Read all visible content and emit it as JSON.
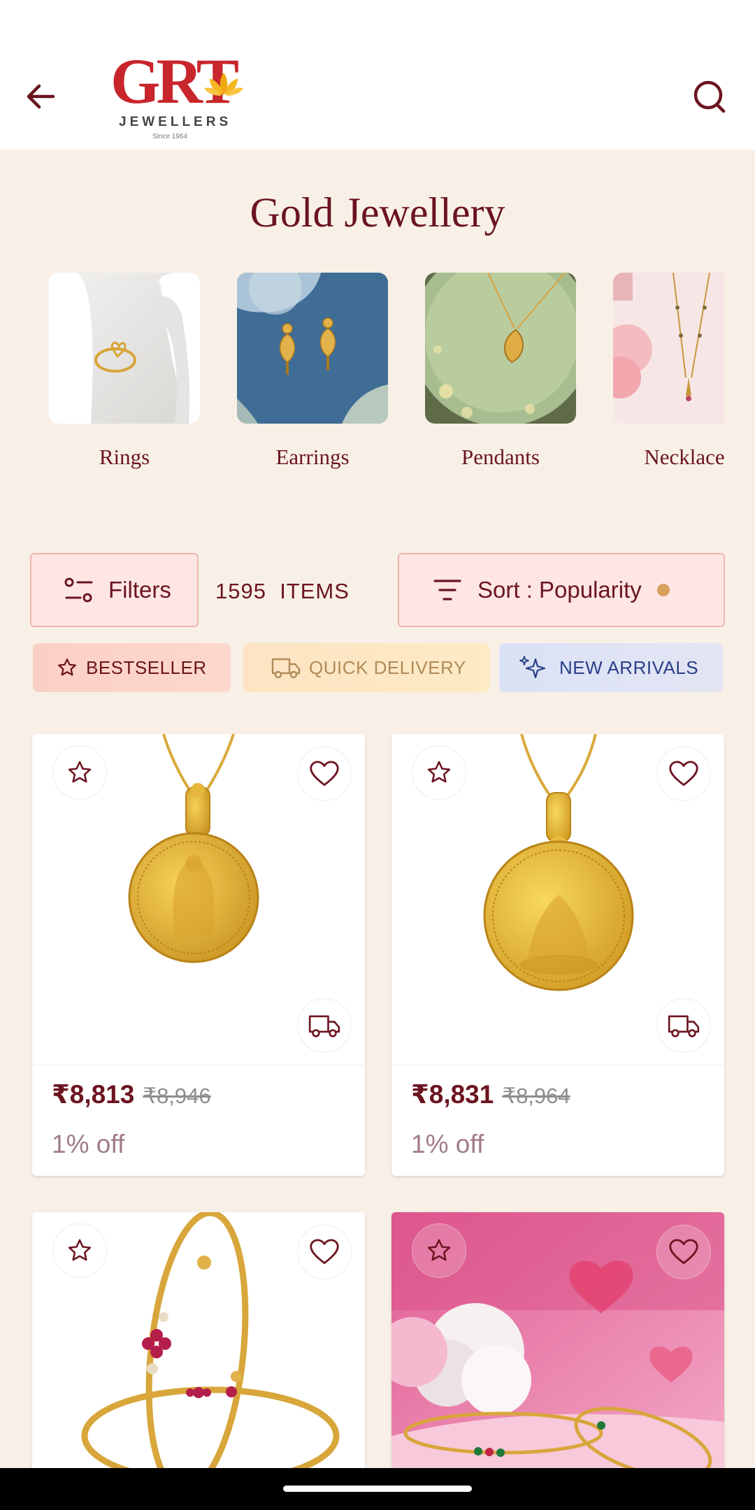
{
  "header": {
    "logo_text": "GRT",
    "logo_sub": "JEWELLERS",
    "logo_since": "Since 1964"
  },
  "page": {
    "title": "Gold Jewellery"
  },
  "categories": [
    {
      "label": "Rings"
    },
    {
      "label": "Earrings"
    },
    {
      "label": "Pendants"
    },
    {
      "label": "Necklaces"
    }
  ],
  "toolbar": {
    "filters_label": "Filters",
    "items_count": "1595  ITEMS",
    "sort_label": "Sort : Popularity"
  },
  "chips": {
    "bestseller": "BESTSELLER",
    "quick_delivery": "QUICK DELIVERY",
    "new_arrivals": "NEW ARRIVALS"
  },
  "products": [
    {
      "price": "₹8,813",
      "mrp": "₹8,946",
      "discount": "1% off"
    },
    {
      "price": "₹8,831",
      "mrp": "₹8,964",
      "discount": "1% off"
    }
  ],
  "colors": {
    "accent": "#6b1420",
    "logo_red": "#c8262c",
    "background": "#f8f0e6",
    "gold": "#d9a05e"
  },
  "icons": [
    "back-arrow-icon",
    "search-icon",
    "filter-sliders-icon",
    "sort-lines-icon",
    "star-icon",
    "truck-icon",
    "sparkle-icon",
    "heart-icon"
  ]
}
